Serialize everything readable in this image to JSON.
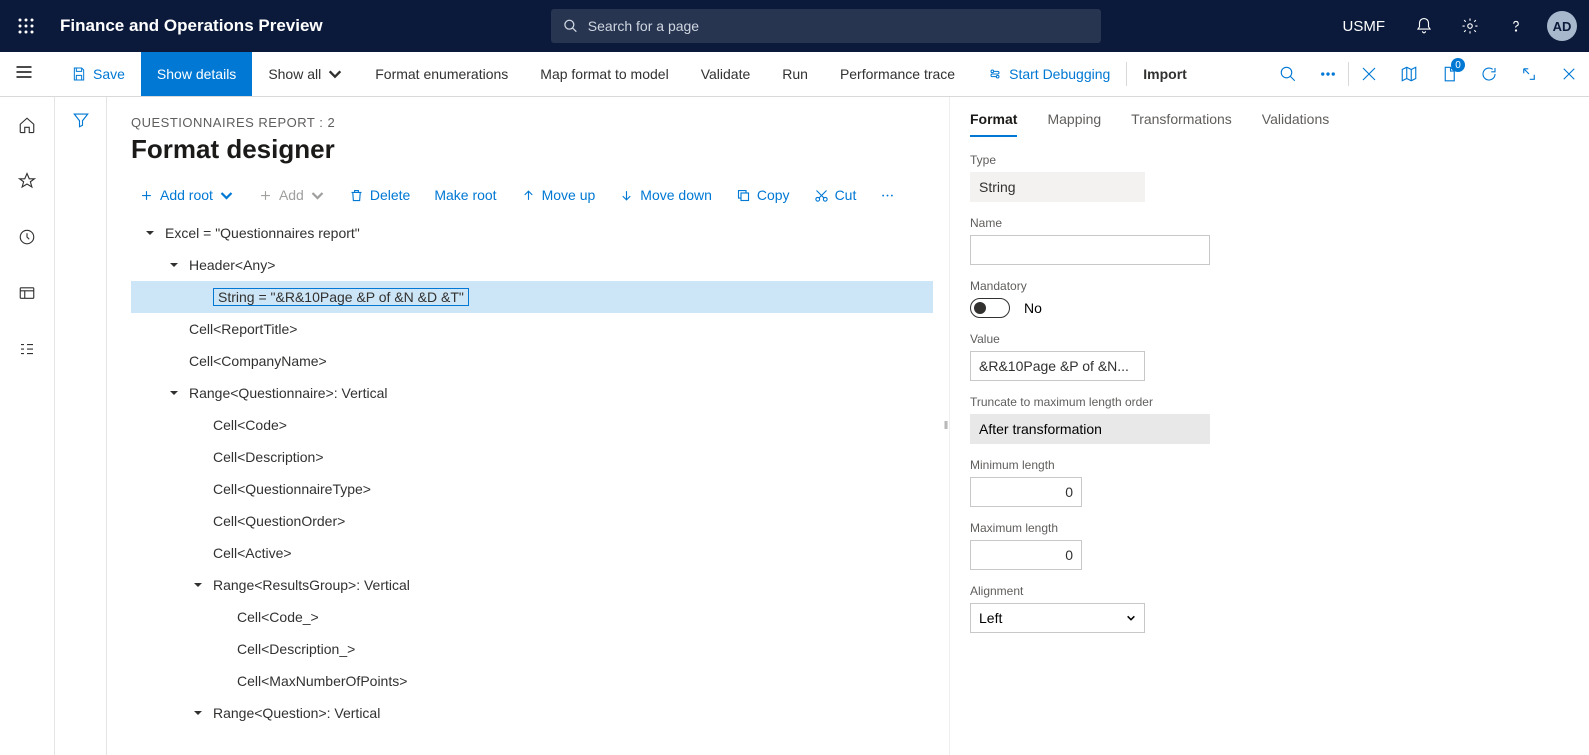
{
  "header": {
    "app_title": "Finance and Operations Preview",
    "search_placeholder": "Search for a page",
    "company": "USMF",
    "avatar": "AD"
  },
  "commands": {
    "save": "Save",
    "show_details": "Show details",
    "show_all": "Show all",
    "format_enum": "Format enumerations",
    "map_format": "Map format to model",
    "validate": "Validate",
    "run": "Run",
    "perf_trace": "Performance trace",
    "start_debug": "Start Debugging",
    "import": "Import",
    "badge_count": "0"
  },
  "page": {
    "breadcrumb": "QUESTIONNAIRES REPORT : 2",
    "title": "Format designer"
  },
  "toolbar": {
    "add_root": "Add root",
    "add": "Add",
    "delete": "Delete",
    "make_root": "Make root",
    "move_up": "Move up",
    "move_down": "Move down",
    "copy": "Copy",
    "cut": "Cut"
  },
  "tree": [
    {
      "indent": 0,
      "caret": true,
      "text": "Excel = \"Questionnaires report\""
    },
    {
      "indent": 1,
      "caret": true,
      "text": "Header<Any>"
    },
    {
      "indent": 2,
      "caret": false,
      "text": "String = \"&R&10Page &P of &N &D &T\"",
      "selected": true
    },
    {
      "indent": 1,
      "caret": false,
      "text": "Cell<ReportTitle>"
    },
    {
      "indent": 1,
      "caret": false,
      "text": "Cell<CompanyName>"
    },
    {
      "indent": 1,
      "caret": true,
      "text": "Range<Questionnaire>: Vertical"
    },
    {
      "indent": 2,
      "caret": false,
      "text": "Cell<Code>"
    },
    {
      "indent": 2,
      "caret": false,
      "text": "Cell<Description>"
    },
    {
      "indent": 2,
      "caret": false,
      "text": "Cell<QuestionnaireType>"
    },
    {
      "indent": 2,
      "caret": false,
      "text": "Cell<QuestionOrder>"
    },
    {
      "indent": 2,
      "caret": false,
      "text": "Cell<Active>"
    },
    {
      "indent": 2,
      "caret": true,
      "text": "Range<ResultsGroup>: Vertical"
    },
    {
      "indent": 3,
      "caret": false,
      "text": "Cell<Code_>"
    },
    {
      "indent": 3,
      "caret": false,
      "text": "Cell<Description_>"
    },
    {
      "indent": 3,
      "caret": false,
      "text": "Cell<MaxNumberOfPoints>"
    },
    {
      "indent": 2,
      "caret": true,
      "text": "Range<Question>: Vertical"
    }
  ],
  "tabs": {
    "format": "Format",
    "mapping": "Mapping",
    "transformations": "Transformations",
    "validations": "Validations"
  },
  "properties": {
    "type_label": "Type",
    "type_value": "String",
    "name_label": "Name",
    "name_value": "",
    "mandatory_label": "Mandatory",
    "mandatory_value": "No",
    "value_label": "Value",
    "value_value": "&R&10Page &P of &N...",
    "truncate_label": "Truncate to maximum length order",
    "truncate_value": "After transformation",
    "minlen_label": "Minimum length",
    "minlen_value": "0",
    "maxlen_label": "Maximum length",
    "maxlen_value": "0",
    "align_label": "Alignment",
    "align_value": "Left"
  }
}
